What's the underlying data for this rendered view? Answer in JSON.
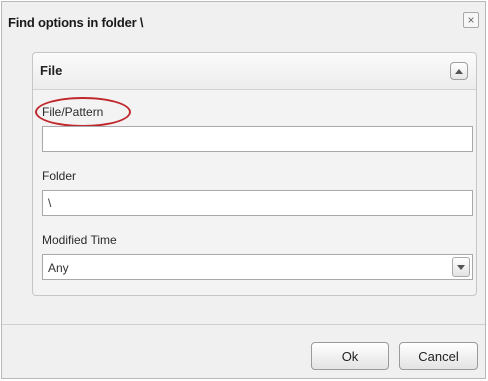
{
  "dialog": {
    "title": "Find options in folder \\",
    "close_glyph": "×"
  },
  "panel": {
    "title": "File",
    "collapse_icon": "chevron-up-icon",
    "fields": {
      "file_pattern": {
        "label": "File/Pattern",
        "value": ""
      },
      "folder": {
        "label": "Folder",
        "value": "\\"
      },
      "modified_time": {
        "label": "Modified Time",
        "value": "Any",
        "icon": "chevron-down-icon"
      }
    }
  },
  "buttons": {
    "ok": "Ok",
    "cancel": "Cancel"
  },
  "colors": {
    "highlight": "#c0282d",
    "dialog_bg": "#f0f0f0",
    "border": "#a9a9a9"
  }
}
